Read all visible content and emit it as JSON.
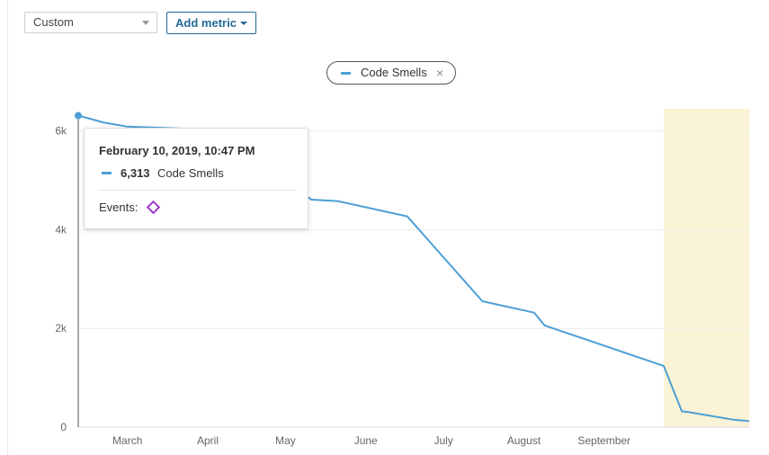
{
  "controls": {
    "select_value": "Custom",
    "add_metric_label": "Add metric"
  },
  "legend": {
    "label": "Code Smells",
    "remove_icon": "×"
  },
  "tooltip": {
    "date": "February 10, 2019, 10:47 PM",
    "value": "6,313",
    "metric": "Code Smells",
    "events_label": "Events:",
    "event_icon": "diamond-icon"
  },
  "colors": {
    "series": "#4b9fd5",
    "highlight": "#fbf3d5",
    "event": "#a336c9",
    "accent": "#236a97"
  },
  "chart_data": {
    "type": "line",
    "title": "",
    "xlabel": "",
    "ylabel": "",
    "x_ticks": [
      "March",
      "April",
      "May",
      "June",
      "July",
      "August",
      "September"
    ],
    "y_ticks": [
      "0",
      "2k",
      "4k",
      "6k"
    ],
    "ylim": [
      0,
      6450
    ],
    "xlim": [
      "2019-02-10",
      "2019-10-27"
    ],
    "series": [
      {
        "name": "Code Smells",
        "points": [
          {
            "x": "2019-02-10",
            "y": 6313
          },
          {
            "x": "2019-02-20",
            "y": 6170
          },
          {
            "x": "2019-03-01",
            "y": 6090
          },
          {
            "x": "2019-03-22",
            "y": 6050
          },
          {
            "x": "2019-04-17",
            "y": 5800
          },
          {
            "x": "2019-04-28",
            "y": 5150
          },
          {
            "x": "2019-05-11",
            "y": 4610
          },
          {
            "x": "2019-05-21",
            "y": 4580
          },
          {
            "x": "2019-06-17",
            "y": 4270
          },
          {
            "x": "2019-07-16",
            "y": 2550
          },
          {
            "x": "2019-08-05",
            "y": 2320
          },
          {
            "x": "2019-08-09",
            "y": 2060
          },
          {
            "x": "2019-09-24",
            "y": 1240
          },
          {
            "x": "2019-10-01",
            "y": 320
          },
          {
            "x": "2019-10-04",
            "y": 300
          },
          {
            "x": "2019-10-21",
            "y": 150
          },
          {
            "x": "2019-10-27",
            "y": 120
          }
        ]
      }
    ],
    "highlight_range": [
      "2019-09-24",
      "2019-10-27"
    ]
  }
}
